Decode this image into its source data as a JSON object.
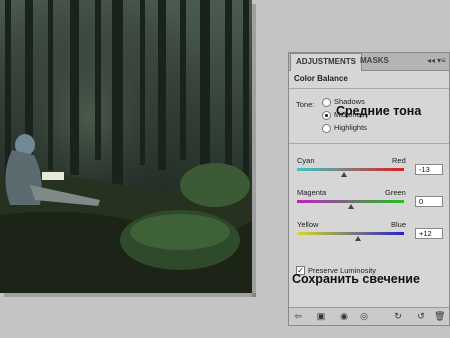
{
  "panel": {
    "tabs": [
      {
        "label": "ADJUSTMENTS"
      },
      {
        "label": "MASKS"
      }
    ],
    "controls": {
      "collapse": "◂◂",
      "menu": "▾≡"
    },
    "title": "Color Balance",
    "tone": {
      "label": "Tone:",
      "options": [
        {
          "label": "Shadows",
          "checked": false
        },
        {
          "label": "Midtones",
          "checked": true
        },
        {
          "label": "Highlights",
          "checked": false
        }
      ]
    },
    "sliders": [
      {
        "left": "Cyan",
        "right": "Red",
        "value": "-13",
        "gradient": [
          "#39c9c9",
          "#e01e1e"
        ]
      },
      {
        "left": "Magenta",
        "right": "Green",
        "value": "0",
        "gradient": [
          "#c21ec2",
          "#1ec21e"
        ]
      },
      {
        "left": "Yellow",
        "right": "Blue",
        "value": "+12",
        "gradient": [
          "#d8d82a",
          "#2424c8"
        ]
      }
    ],
    "preserve": {
      "label": "Preserve Luminosity",
      "checked": true
    },
    "footer_icons": [
      "back-arrow-icon",
      "screen-mode-icon",
      "visibility-eye-icon",
      "view-previous-icon",
      "reset-icon",
      "trash-icon"
    ]
  },
  "overlay": {
    "midtones_ru": "Средние тона",
    "preserve_ru": "Сохранить свечение"
  }
}
